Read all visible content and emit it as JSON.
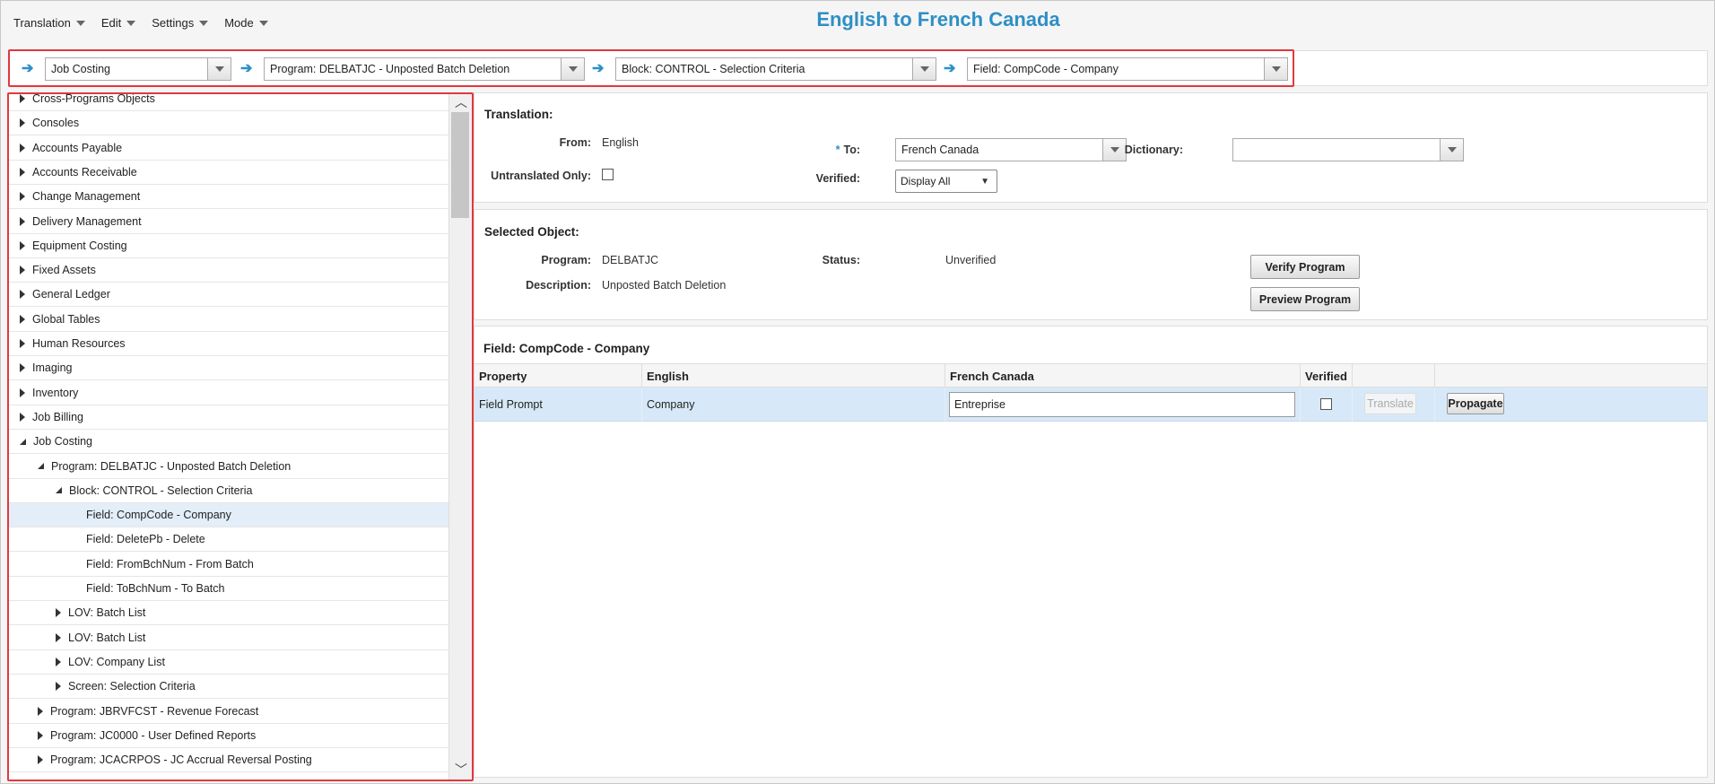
{
  "menu": [
    {
      "label": "Translation"
    },
    {
      "label": "Edit"
    },
    {
      "label": "Settings"
    },
    {
      "label": "Mode"
    }
  ],
  "page_title": "English to French Canada",
  "breadcrumb": {
    "module": "Job Costing",
    "program": "Program: DELBATJC - Unposted Batch Deletion",
    "block": "Block: CONTROL - Selection Criteria",
    "field": "Field: CompCode - Company"
  },
  "tree": [
    {
      "label": "Cross-Programs Objects",
      "state": "collapsed",
      "level": 0
    },
    {
      "label": "Consoles",
      "state": "collapsed",
      "level": 0
    },
    {
      "label": "Accounts Payable",
      "state": "collapsed",
      "level": 0
    },
    {
      "label": "Accounts Receivable",
      "state": "collapsed",
      "level": 0
    },
    {
      "label": "Change Management",
      "state": "collapsed",
      "level": 0
    },
    {
      "label": "Delivery Management",
      "state": "collapsed",
      "level": 0
    },
    {
      "label": "Equipment Costing",
      "state": "collapsed",
      "level": 0
    },
    {
      "label": "Fixed Assets",
      "state": "collapsed",
      "level": 0
    },
    {
      "label": "General Ledger",
      "state": "collapsed",
      "level": 0
    },
    {
      "label": "Global Tables",
      "state": "collapsed",
      "level": 0
    },
    {
      "label": "Human Resources",
      "state": "collapsed",
      "level": 0
    },
    {
      "label": "Imaging",
      "state": "collapsed",
      "level": 0
    },
    {
      "label": "Inventory",
      "state": "collapsed",
      "level": 0
    },
    {
      "label": "Job Billing",
      "state": "collapsed",
      "level": 0
    },
    {
      "label": "Job Costing",
      "state": "expanded",
      "level": 0
    },
    {
      "label": "Program: DELBATJC - Unposted Batch Deletion",
      "state": "expanded",
      "level": 1
    },
    {
      "label": "Block: CONTROL - Selection Criteria",
      "state": "expanded",
      "level": 2
    },
    {
      "label": "Field: CompCode - Company",
      "state": "leaf",
      "level": 3,
      "selected": true
    },
    {
      "label": "Field: DeletePb - Delete",
      "state": "leaf",
      "level": 3
    },
    {
      "label": "Field: FromBchNum - From Batch",
      "state": "leaf",
      "level": 3
    },
    {
      "label": "Field: ToBchNum - To Batch",
      "state": "leaf",
      "level": 3
    },
    {
      "label": "LOV: Batch List",
      "state": "collapsed",
      "level": 2
    },
    {
      "label": "LOV: Batch List",
      "state": "collapsed",
      "level": 2
    },
    {
      "label": "LOV: Company List",
      "state": "collapsed",
      "level": 2
    },
    {
      "label": "Screen: Selection Criteria",
      "state": "collapsed",
      "level": 2
    },
    {
      "label": "Program: JBRVFCST - Revenue Forecast",
      "state": "collapsed",
      "level": 1
    },
    {
      "label": "Program: JC0000 - User Defined Reports",
      "state": "collapsed",
      "level": 1
    },
    {
      "label": "Program: JCACRPOS - JC Accrual Reversal Posting",
      "state": "collapsed",
      "level": 1
    }
  ],
  "translation": {
    "heading": "Translation:",
    "from_label": "From:",
    "from_value": "English",
    "untranslated_label": "Untranslated Only:",
    "to_required": "*",
    "to_label": "To:",
    "to_value": "French Canada",
    "verified_label": "Verified:",
    "verified_value": "Display All",
    "dictionary_label": "Dictionary:",
    "dictionary_value": ""
  },
  "selected_object": {
    "heading": "Selected Object:",
    "program_label": "Program:",
    "program_value": "DELBATJC",
    "description_label": "Description:",
    "description_value": "Unposted Batch Deletion",
    "status_label": "Status:",
    "status_value": "Unverified",
    "verify_button": "Verify Program",
    "preview_button": "Preview Program"
  },
  "field_panel": {
    "heading": "Field: CompCode - Company",
    "columns": [
      "Property",
      "English",
      "French Canada",
      "Verified",
      "",
      ""
    ],
    "rows": [
      {
        "property": "Field Prompt",
        "english": "Company",
        "french": "Entreprise",
        "verified": false,
        "translate_label": "Translate",
        "propagate_label": "Propagate"
      }
    ]
  }
}
